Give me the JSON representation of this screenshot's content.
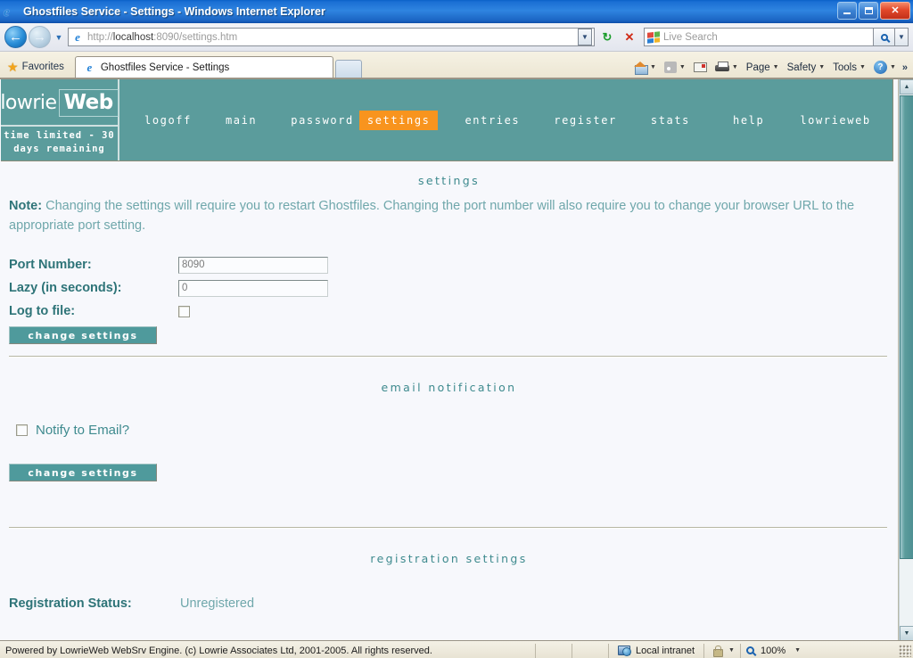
{
  "window": {
    "title": "Ghostfiles Service - Settings - Windows Internet Explorer",
    "minimize_label": "Minimize",
    "restore_label": "Restore",
    "close_label": "Close"
  },
  "browser": {
    "back_glyph": "←",
    "forward_glyph": "→",
    "history_caret": "▼",
    "url_scheme": "http://",
    "url_host": "localhost",
    "url_rest": ":8090/settings.htm",
    "url_full": "http://localhost:8090/settings.htm",
    "url_dropdown_glyph": "▼",
    "refresh_glyph": "↻",
    "stop_glyph": "✕",
    "search_placeholder": "Live Search",
    "search_dropdown_glyph": "▼",
    "favorites_label": "Favorites",
    "tab_label": "Ghostfiles Service - Settings",
    "commands": [
      {
        "label": "",
        "icon": "home-icon",
        "caret": "▼"
      },
      {
        "label": "",
        "icon": "feed-icon",
        "caret": "▼"
      },
      {
        "label": "",
        "icon": "mail-icon",
        "caret": ""
      },
      {
        "label": "",
        "icon": "print-icon",
        "caret": "▼"
      },
      {
        "label": "Page",
        "icon": "",
        "caret": "▼"
      },
      {
        "label": "Safety",
        "icon": "",
        "caret": "▼"
      },
      {
        "label": "Tools",
        "icon": "",
        "caret": "▼"
      },
      {
        "label": "",
        "icon": "help-icon",
        "caret": "▼"
      }
    ],
    "overflow_glyph": "»"
  },
  "page": {
    "brand": {
      "word1": "lowrie",
      "word2": "Web",
      "license_line1": "time limited - 30",
      "license_line2": "days remaining"
    },
    "nav": [
      {
        "label": "logoff",
        "active": false
      },
      {
        "label": "main",
        "active": false
      },
      {
        "label": "password",
        "active": false
      },
      {
        "label": "settings",
        "active": true
      },
      {
        "label": "entries",
        "active": false
      },
      {
        "label": "register",
        "active": false
      },
      {
        "label": "stats",
        "active": false
      },
      {
        "label": "help",
        "active": false
      },
      {
        "label": "lowrieweb",
        "active": false
      }
    ],
    "settings_section": {
      "title": "settings",
      "note_prefix": "Note:",
      "note_text": " Changing the settings will require you to restart Ghostfiles. Changing the port number will also require you to change your browser URL to the appropriate port setting.",
      "port_label": "Port Number:",
      "port_value": "8090",
      "lazy_label": "Lazy (in seconds):",
      "lazy_value": "0",
      "log_label": "Log to file:",
      "log_checked": false,
      "button_label": "change settings"
    },
    "email_section": {
      "title": "email notification",
      "notify_label": "Notify to Email?",
      "notify_checked": false,
      "button_label": "change settings"
    },
    "registration_section": {
      "title": "registration settings",
      "status_label": "Registration Status:",
      "status_value": "Unregistered"
    },
    "scrollbar": {
      "up_glyph": "▲",
      "down_glyph": "▼"
    }
  },
  "statusbar": {
    "message": "Powered by LowrieWeb WebSrv Engine. (c) Lowrie Associates Ltd, 2001-2005. All rights reserved.",
    "zone": "Local intranet",
    "zone_caret": "▼",
    "zoom": "100%",
    "zoom_caret": "▼"
  },
  "colors": {
    "brand_teal": "#5b9c9c",
    "accent_orange": "#f8941e",
    "heading_teal": "#3e8a8e",
    "label_teal": "#2e7478",
    "body_text_teal": "#6fa7ab",
    "page_bg": "#f7f8fc",
    "titlebar_blue": "#1a6fd4"
  }
}
